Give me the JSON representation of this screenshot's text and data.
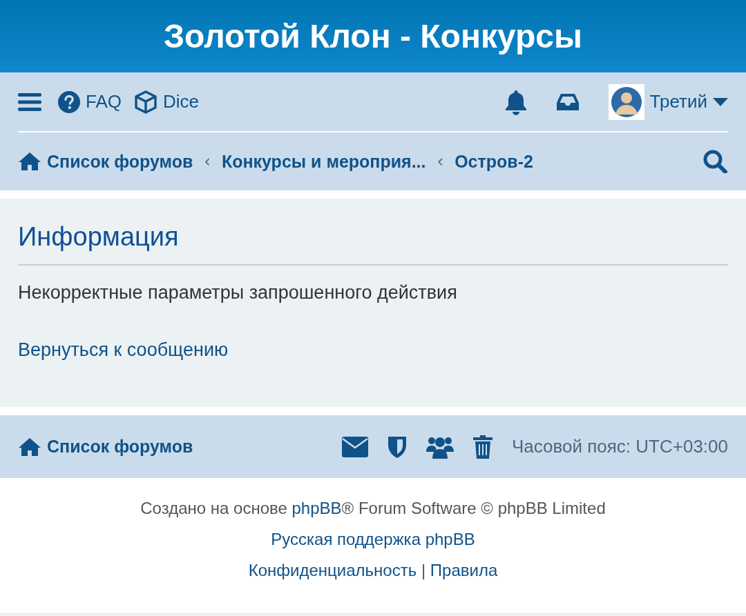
{
  "site_title": "Золотой Клон - Конкурсы",
  "nav": {
    "links": [
      {
        "kind": "faq",
        "label": "FAQ"
      },
      {
        "kind": "dice",
        "label": "Dice"
      }
    ],
    "username": "Третий"
  },
  "breadcrumbs": [
    "Список форумов",
    "Конкурсы и мероприя...",
    "Остров-2"
  ],
  "breadcrumb_separators": [
    "‹",
    "‹"
  ],
  "panel": {
    "title": "Информация",
    "message": "Некорректные параметры запрошенного действия",
    "link": "Вернуться к сообщению"
  },
  "footer_nav": {
    "home": "Список форумов",
    "timezone": "Часовой пояс: UTC+03:00"
  },
  "copyright": {
    "prefix": "Создано на основе ",
    "link": "phpBB",
    "suffix": "® Forum Software © phpBB Limited",
    "support": "Русская поддержка phpBB",
    "privacy": "Конфиденциальность",
    "separator": "|",
    "terms": "Правила"
  }
}
